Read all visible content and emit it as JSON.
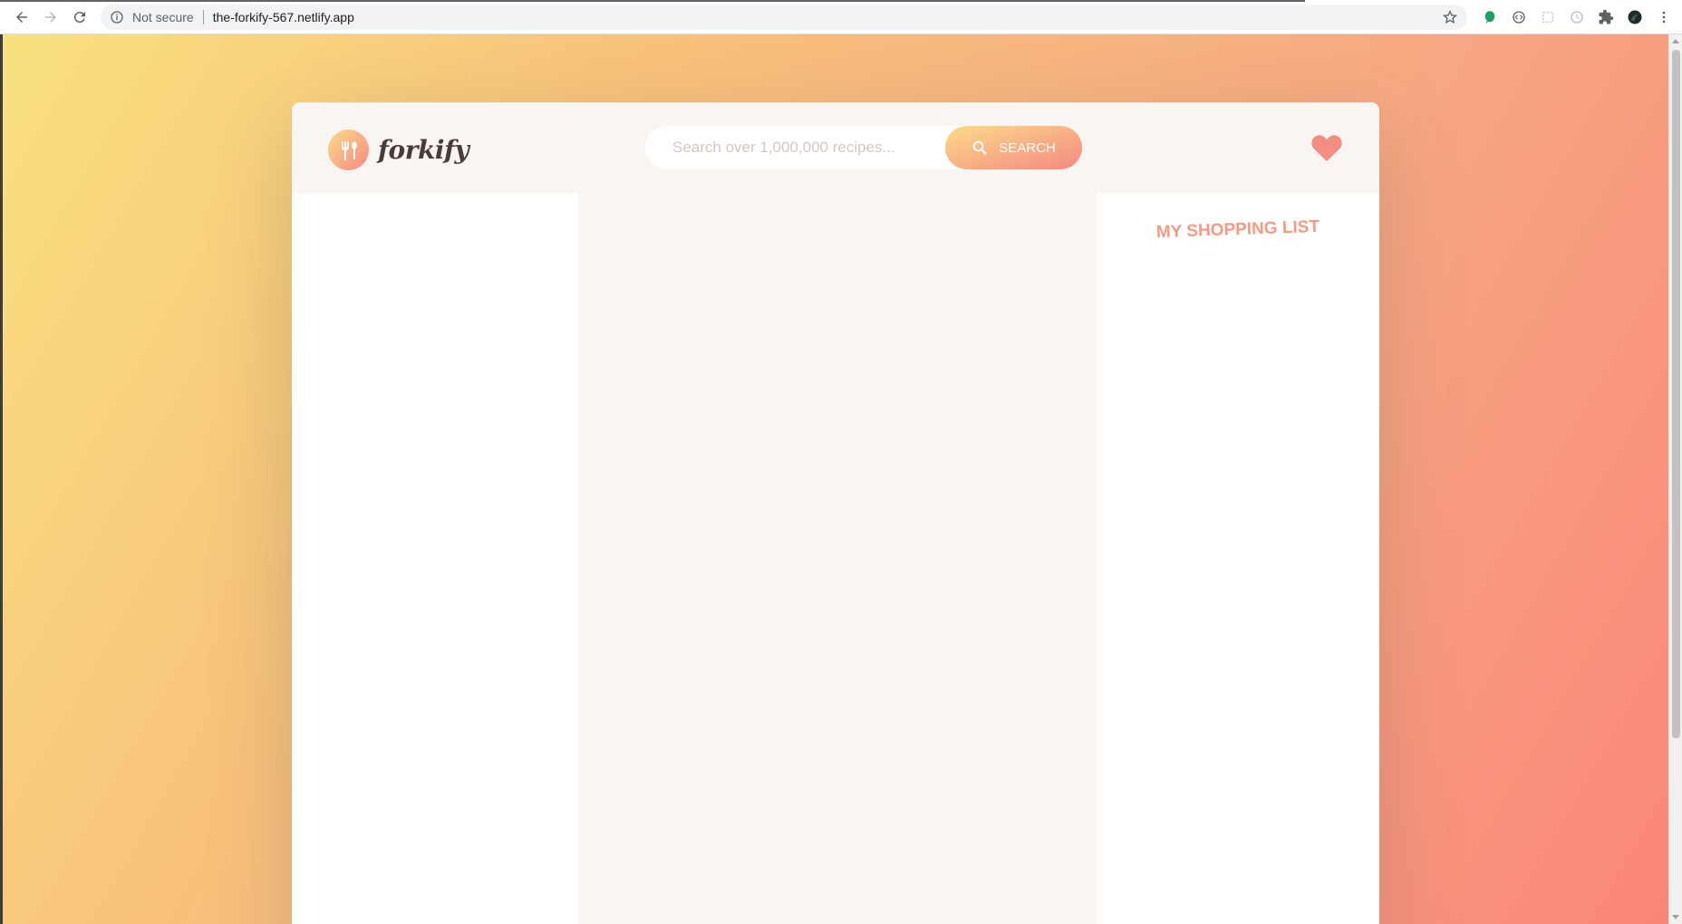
{
  "browser": {
    "security_label": "Not secure",
    "url": "the-forkify-567.netlify.app"
  },
  "app": {
    "logo_text": "forkify",
    "search": {
      "placeholder": "Search over 1,000,000 recipes...",
      "value": "",
      "button_label": "SEARCH"
    },
    "shopping_list": {
      "title": "MY SHOPPING LIST"
    }
  },
  "colors": {
    "accent": "#f48982",
    "accent_light": "#fbdb89",
    "header_bg": "#f9f5f3",
    "logo_text": "#4a3b3b",
    "shopping_title": "#f59a83"
  },
  "icons": {
    "logo": "fork-spoon-icon",
    "search": "search-icon",
    "likes": "heart-icon"
  }
}
